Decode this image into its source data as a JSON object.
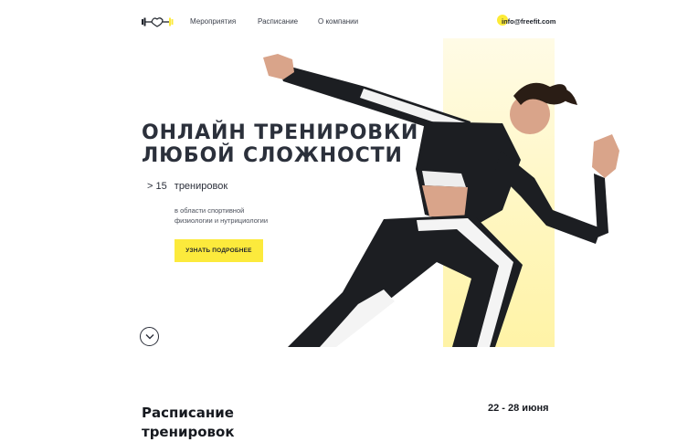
{
  "header": {
    "logo_icon": "dumbbell-heart-icon",
    "nav": [
      "Мероприятия",
      "Расписание",
      "О компании"
    ],
    "email": "info@freefit.com"
  },
  "hero": {
    "title_lines": [
      "ОНЛАЙН ТРЕНИРОВКИ",
      "ЛЮБОЙ СЛОЖНОСТИ"
    ],
    "stat_number": "> 15",
    "stat_label": "тренировок",
    "description_lines": [
      "в области спортивной",
      "физиологии и нутрициологии"
    ],
    "cta_label": "УЗНАТЬ ПОДРОБНЕЕ",
    "scroll_icon": "chevron-down-icon",
    "image": "athlete-running-photo"
  },
  "schedule": {
    "title_lines": [
      "Расписание",
      "тренировок"
    ],
    "date_range": "22 - 28 июня"
  },
  "colors": {
    "accent": "#fcea3c",
    "text_dark": "#2b303b"
  }
}
